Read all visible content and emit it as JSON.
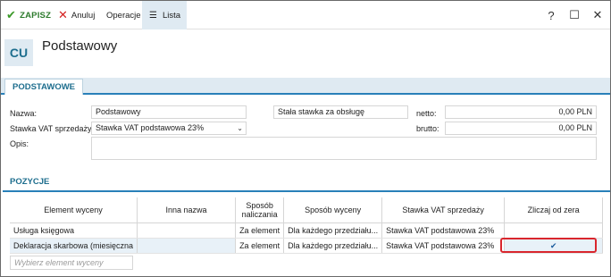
{
  "toolbar": {
    "save_label": "ZAPISZ",
    "cancel_label": "Anuluj",
    "operations_label": "Operacje",
    "list_label": "Lista"
  },
  "window_controls": {
    "help": "?",
    "minimize": "—",
    "maximize": "☐",
    "close": "✕"
  },
  "header": {
    "badge": "CU",
    "title": "Podstawowy"
  },
  "tab": {
    "label": "PODSTAWOWE"
  },
  "form": {
    "name_label": "Nazwa:",
    "name_value": "Podstawowy",
    "vat_label": "Stawka VAT sprzedaży:",
    "vat_value": "Stawka VAT podstawowa 23%",
    "desc_label": "Opis:",
    "desc_value": "",
    "fixed_rate_value": "Stała stawka za obsługę",
    "net_label": "netto:",
    "net_value": "0,00 PLN",
    "gross_label": "brutto:",
    "gross_value": "0,00 PLN"
  },
  "positions": {
    "title": "POZYCJE",
    "columns": [
      "Element wyceny",
      "Inna nazwa",
      "Sposób naliczania",
      "Sposób wyceny",
      "Stawka VAT sprzedaży",
      "Zliczaj od zera"
    ],
    "rows": [
      {
        "element": "Usługa księgowa",
        "other_name": "",
        "charging": "Za element",
        "pricing": "Dla każdego przedziału...",
        "vat": "Stawka VAT podstawowa 23%",
        "zero": false
      },
      {
        "element": "Deklaracja skarbowa (miesięczna",
        "other_name": "",
        "charging": "Za element",
        "pricing": "Dla każdego przedziału...",
        "vat": "Stawka VAT podstawowa 23%",
        "zero": true
      }
    ],
    "new_row_placeholder": "Wybierz element wyceny"
  },
  "colors": {
    "accent": "#1e6e8e",
    "section_bg": "#dfeaf2",
    "save_green": "#3c9a2a",
    "cancel_red": "#d42020",
    "highlight_red": "#d9262d"
  }
}
